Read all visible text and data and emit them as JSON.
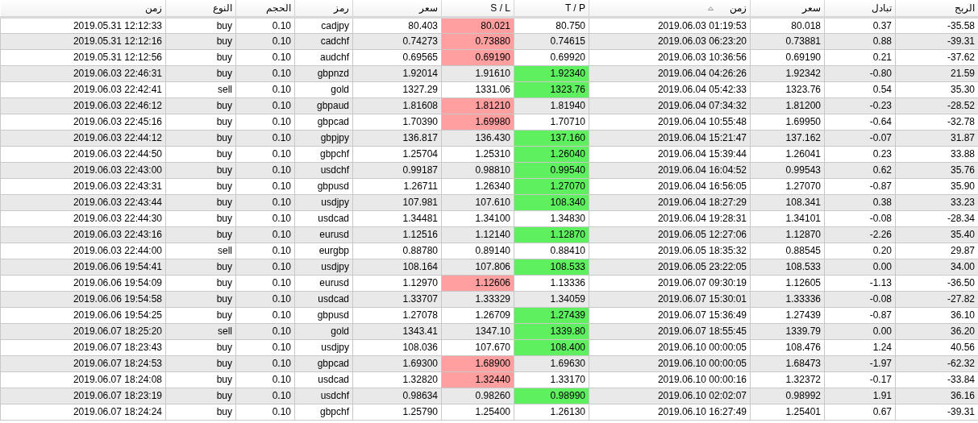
{
  "columns": [
    {
      "label": "الربح",
      "sorted": false
    },
    {
      "label": "تبادل",
      "sorted": false
    },
    {
      "label": "سعر",
      "sorted": false
    },
    {
      "label": "زمن",
      "sorted": true
    },
    {
      "label": "T / P",
      "sorted": false
    },
    {
      "label": "S / L",
      "sorted": false
    },
    {
      "label": "سعر",
      "sorted": false
    },
    {
      "label": "رمز",
      "sorted": false
    },
    {
      "label": "الحجم",
      "sorted": false
    },
    {
      "label": "النوع",
      "sorted": false
    },
    {
      "label": "زمن",
      "sorted": false
    }
  ],
  "rows": [
    {
      "cells": [
        "2019.05.31 12:12:33",
        "buy",
        "0.10",
        "cadjpy",
        "80.403",
        "80.021",
        "80.750",
        "2019.06.03 01:19:53",
        "80.018",
        "0.37",
        "-35.58"
      ],
      "sl_hit": true,
      "tp_hit": false
    },
    {
      "cells": [
        "2019.05.31 12:12:16",
        "buy",
        "0.10",
        "cadchf",
        "0.74273",
        "0.73880",
        "0.74615",
        "2019.06.03 06:23:20",
        "0.73881",
        "0.88",
        "-39.31"
      ],
      "sl_hit": true,
      "tp_hit": false
    },
    {
      "cells": [
        "2019.05.31 12:12:56",
        "buy",
        "0.10",
        "audchf",
        "0.69565",
        "0.69190",
        "0.69920",
        "2019.06.03 10:36:56",
        "0.69190",
        "0.21",
        "-37.62"
      ],
      "sl_hit": true,
      "tp_hit": false
    },
    {
      "cells": [
        "2019.06.03 22:46:31",
        "buy",
        "0.10",
        "gbpnzd",
        "1.92014",
        "1.91610",
        "1.92340",
        "2019.06.04 04:26:26",
        "1.92342",
        "-0.80",
        "21.59"
      ],
      "sl_hit": false,
      "tp_hit": true
    },
    {
      "cells": [
        "2019.06.03 22:42:41",
        "sell",
        "0.10",
        "gold",
        "1327.29",
        "1331.06",
        "1323.76",
        "2019.06.04 05:42:33",
        "1323.76",
        "0.54",
        "35.30"
      ],
      "sl_hit": false,
      "tp_hit": true
    },
    {
      "cells": [
        "2019.06.03 22:46:12",
        "buy",
        "0.10",
        "gbpaud",
        "1.81608",
        "1.81210",
        "1.81940",
        "2019.06.04 07:34:32",
        "1.81200",
        "-0.23",
        "-28.52"
      ],
      "sl_hit": true,
      "tp_hit": false
    },
    {
      "cells": [
        "2019.06.03 22:45:16",
        "buy",
        "0.10",
        "gbpcad",
        "1.70390",
        "1.69980",
        "1.70710",
        "2019.06.04 10:55:48",
        "1.69950",
        "-0.64",
        "-32.78"
      ],
      "sl_hit": true,
      "tp_hit": false
    },
    {
      "cells": [
        "2019.06.03 22:44:12",
        "buy",
        "0.10",
        "gbpjpy",
        "136.817",
        "136.430",
        "137.160",
        "2019.06.04 15:21:47",
        "137.162",
        "-0.07",
        "31.87"
      ],
      "sl_hit": false,
      "tp_hit": true
    },
    {
      "cells": [
        "2019.06.03 22:44:50",
        "buy",
        "0.10",
        "gbpchf",
        "1.25704",
        "1.25310",
        "1.26040",
        "2019.06.04 15:39:44",
        "1.26041",
        "0.23",
        "33.88"
      ],
      "sl_hit": false,
      "tp_hit": true
    },
    {
      "cells": [
        "2019.06.03 22:43:00",
        "buy",
        "0.10",
        "usdchf",
        "0.99187",
        "0.98810",
        "0.99540",
        "2019.06.04 16:04:52",
        "0.99543",
        "0.62",
        "35.76"
      ],
      "sl_hit": false,
      "tp_hit": true
    },
    {
      "cells": [
        "2019.06.03 22:43:31",
        "buy",
        "0.10",
        "gbpusd",
        "1.26711",
        "1.26340",
        "1.27070",
        "2019.06.04 16:56:05",
        "1.27070",
        "-0.87",
        "35.90"
      ],
      "sl_hit": false,
      "tp_hit": true
    },
    {
      "cells": [
        "2019.06.03 22:43:44",
        "buy",
        "0.10",
        "usdjpy",
        "107.981",
        "107.610",
        "108.340",
        "2019.06.04 18:27:29",
        "108.341",
        "0.38",
        "33.23"
      ],
      "sl_hit": false,
      "tp_hit": true
    },
    {
      "cells": [
        "2019.06.03 22:44:30",
        "buy",
        "0.10",
        "usdcad",
        "1.34481",
        "1.34100",
        "1.34830",
        "2019.06.04 19:28:31",
        "1.34101",
        "-0.08",
        "-28.34"
      ],
      "sl_hit": false,
      "tp_hit": false
    },
    {
      "cells": [
        "2019.06.03 22:43:16",
        "buy",
        "0.10",
        "eurusd",
        "1.12516",
        "1.12140",
        "1.12870",
        "2019.06.05 12:27:06",
        "1.12870",
        "-2.26",
        "35.40"
      ],
      "sl_hit": false,
      "tp_hit": true
    },
    {
      "cells": [
        "2019.06.03 22:44:00",
        "sell",
        "0.10",
        "eurgbp",
        "0.88780",
        "0.89140",
        "0.88410",
        "2019.06.05 18:35:32",
        "0.88545",
        "0.20",
        "29.87"
      ],
      "sl_hit": false,
      "tp_hit": false
    },
    {
      "cells": [
        "2019.06.06 19:54:41",
        "buy",
        "0.10",
        "usdjpy",
        "108.164",
        "107.806",
        "108.533",
        "2019.06.05 23:22:05",
        "108.533",
        "0.00",
        "34.00"
      ],
      "sl_hit": false,
      "tp_hit": true
    },
    {
      "cells": [
        "2019.06.06 19:54:09",
        "buy",
        "0.10",
        "eurusd",
        "1.12970",
        "1.12606",
        "1.13336",
        "2019.06.07 09:30:19",
        "1.12605",
        "-1.13",
        "-36.50"
      ],
      "sl_hit": true,
      "tp_hit": false
    },
    {
      "cells": [
        "2019.06.06 19:54:58",
        "buy",
        "0.10",
        "usdcad",
        "1.33707",
        "1.33329",
        "1.34059",
        "2019.06.07 15:30:01",
        "1.33336",
        "-0.08",
        "-27.82"
      ],
      "sl_hit": false,
      "tp_hit": false
    },
    {
      "cells": [
        "2019.06.06 19:54:25",
        "buy",
        "0.10",
        "gbpusd",
        "1.27078",
        "1.26709",
        "1.27439",
        "2019.06.07 15:36:49",
        "1.27439",
        "-0.87",
        "36.10"
      ],
      "sl_hit": false,
      "tp_hit": true
    },
    {
      "cells": [
        "2019.06.07 18:25:20",
        "sell",
        "0.10",
        "gold",
        "1343.41",
        "1347.10",
        "1339.80",
        "2019.06.07 18:55:45",
        "1339.79",
        "0.00",
        "36.20"
      ],
      "sl_hit": false,
      "tp_hit": true
    },
    {
      "cells": [
        "2019.06.07 18:23:43",
        "buy",
        "0.10",
        "usdjpy",
        "108.036",
        "107.670",
        "108.400",
        "2019.06.10 00:00:05",
        "108.476",
        "1.24",
        "40.56"
      ],
      "sl_hit": false,
      "tp_hit": true
    },
    {
      "cells": [
        "2019.06.07 18:24:53",
        "buy",
        "0.10",
        "gbpcad",
        "1.69300",
        "1.68900",
        "1.69630",
        "2019.06.10 00:00:05",
        "1.68473",
        "-1.97",
        "-62.32"
      ],
      "sl_hit": true,
      "tp_hit": false
    },
    {
      "cells": [
        "2019.06.07 18:24:08",
        "buy",
        "0.10",
        "usdcad",
        "1.32820",
        "1.32440",
        "1.33170",
        "2019.06.10 00:00:16",
        "1.32372",
        "-0.17",
        "-33.84"
      ],
      "sl_hit": true,
      "tp_hit": false
    },
    {
      "cells": [
        "2019.06.07 18:23:19",
        "buy",
        "0.10",
        "usdchf",
        "0.98634",
        "0.98260",
        "0.98990",
        "2019.06.10 02:02:07",
        "0.98992",
        "1.91",
        "36.16"
      ],
      "sl_hit": false,
      "tp_hit": true
    },
    {
      "cells": [
        "2019.06.07 18:24:24",
        "buy",
        "0.10",
        "gbpchf",
        "1.25790",
        "1.25400",
        "1.26130",
        "2019.06.10 16:27:49",
        "1.25401",
        "0.67",
        "-39.31"
      ],
      "sl_hit": false,
      "tp_hit": false
    }
  ]
}
